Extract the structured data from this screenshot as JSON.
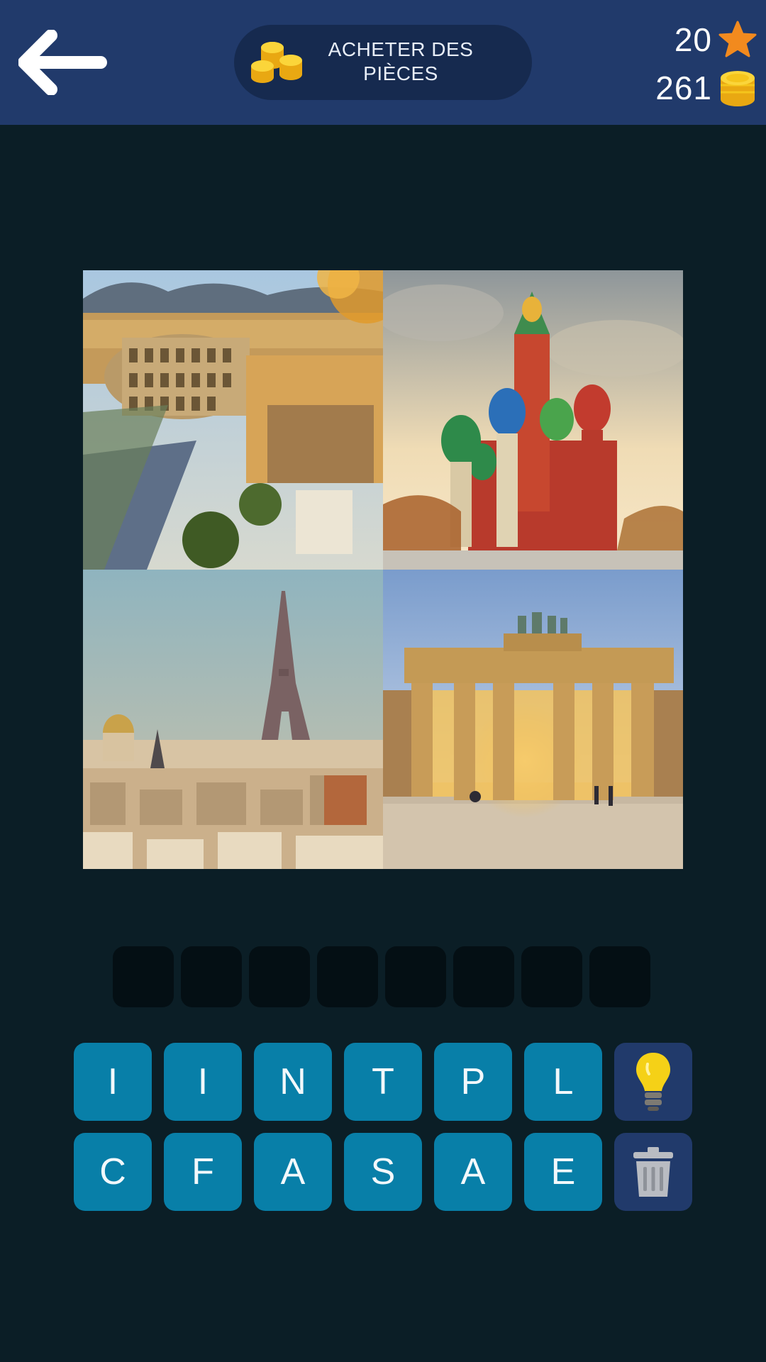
{
  "header": {
    "buy_button_label": "ACHETER DES PIÈCES",
    "stars_count": "20",
    "coins_count": "261"
  },
  "icons": {
    "back": "arrow-left-icon",
    "buy": "coin-stack-icon",
    "stars": "star-icon",
    "coins": "coin-icon",
    "hint": "lightbulb-icon",
    "delete": "trash-icon"
  },
  "puzzle": {
    "photos": [
      {
        "subject": "colosseum"
      },
      {
        "subject": "st-basils-cathedral"
      },
      {
        "subject": "eiffel-tower"
      },
      {
        "subject": "brandenburg-gate"
      }
    ],
    "answer_slots": [
      "",
      "",
      "",
      "",
      "",
      "",
      "",
      ""
    ],
    "letters_row1": [
      "I",
      "I",
      "N",
      "T",
      "P",
      "L"
    ],
    "letters_row2": [
      "C",
      "F",
      "A",
      "S",
      "A",
      "E"
    ]
  },
  "colors": {
    "header_bg": "#213a6b",
    "page_bg": "#0b1e26",
    "key_bg": "#087fa8",
    "action_key_bg": "#213a6b",
    "slot_bg": "#040f14",
    "star": "#f28a1e",
    "coin": "#f5c51c"
  }
}
